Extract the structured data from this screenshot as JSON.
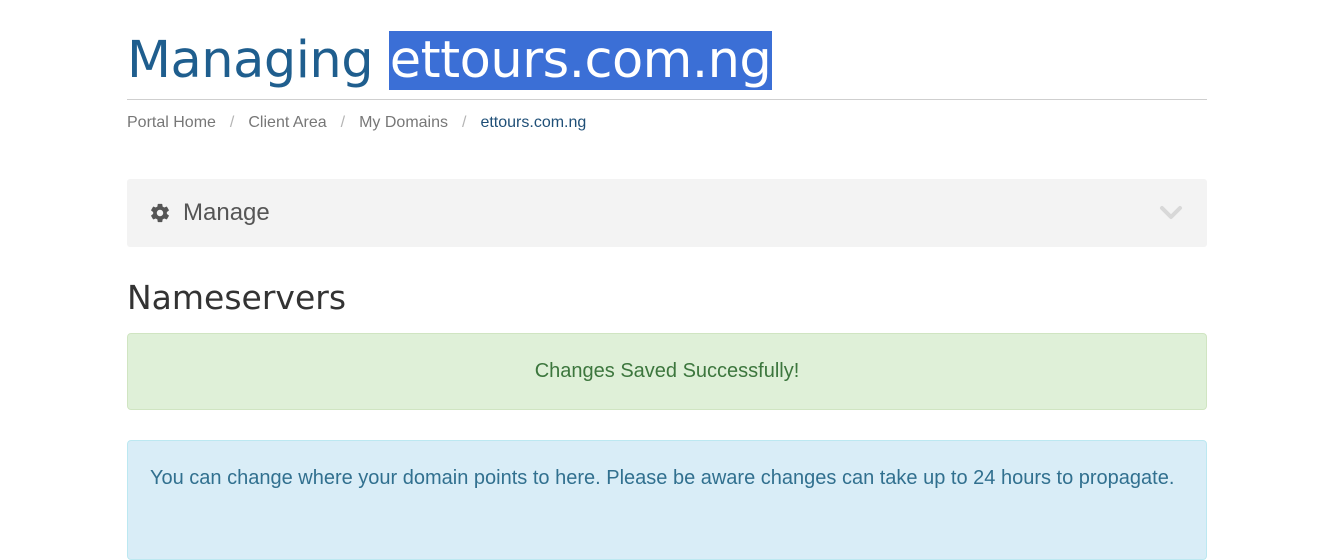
{
  "header": {
    "title_prefix": "Managing",
    "title_domain": "ettours.com.ng"
  },
  "breadcrumb": {
    "items": [
      "Portal Home",
      "Client Area",
      "My Domains"
    ],
    "active": "ettours.com.ng",
    "separator": "/"
  },
  "manage_panel": {
    "label": "Manage",
    "icon": "gear-icon",
    "toggle_icon": "chevron-down-icon"
  },
  "section": {
    "title": "Nameservers"
  },
  "alerts": {
    "success": "Changes Saved Successfully!",
    "info": "You can change where your domain points to here. Please be aware changes can take up to 24 hours to propagate."
  },
  "colors": {
    "title": "#1f5e8e",
    "selection_highlight": "#3b6fd6",
    "success_bg": "#dff0d8",
    "success_text": "#3c763d",
    "info_bg": "#d9edf7",
    "info_text": "#31708f",
    "panel_bg": "#f3f3f3"
  }
}
